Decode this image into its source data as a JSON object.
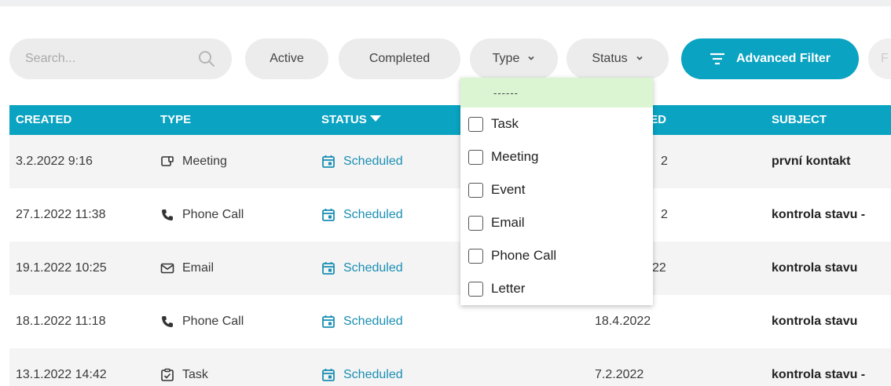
{
  "filters": {
    "search_placeholder": "Search...",
    "active": "Active",
    "completed": "Completed",
    "type": "Type",
    "status": "Status",
    "advanced_filter": "Advanced Filter",
    "more": "F"
  },
  "table": {
    "headers": {
      "created": "CREATED",
      "type": "TYPE",
      "status": "STATUS",
      "scheduled": "LED",
      "subject": "SUBJECT"
    },
    "rows": [
      {
        "created": "3.2.2022 9:16",
        "type": "Meeting",
        "type_icon": "meeting-icon",
        "status": "Scheduled",
        "scheduled": "2",
        "subject": "první kontakt"
      },
      {
        "created": "27.1.2022 11:38",
        "type": "Phone Call",
        "type_icon": "phone-icon",
        "status": "Scheduled",
        "scheduled": "2",
        "subject": "kontrola stavu -"
      },
      {
        "created": "19.1.2022 10:25",
        "type": "Email",
        "type_icon": "email-icon",
        "status": "Scheduled",
        "scheduled": "22",
        "subject": "kontrola stavu"
      },
      {
        "created": "18.1.2022 11:18",
        "type": "Phone Call",
        "type_icon": "phone-icon",
        "status": "Scheduled",
        "scheduled": "18.4.2022",
        "subject": "kontrola stavu"
      },
      {
        "created": "13.1.2022 14:42",
        "type": "Task",
        "type_icon": "task-icon",
        "status": "Scheduled",
        "scheduled": "7.2.2022",
        "subject": "kontrola stavu -"
      }
    ]
  },
  "type_dropdown": {
    "empty_option": "------",
    "options": [
      "Task",
      "Meeting",
      "Event",
      "Email",
      "Phone Call",
      "Letter"
    ]
  },
  "colors": {
    "accent": "#0aa3c2",
    "status_text": "#1a8fb3",
    "selected_option_bg": "#dbf5d3",
    "pill_bg": "#ececec"
  }
}
